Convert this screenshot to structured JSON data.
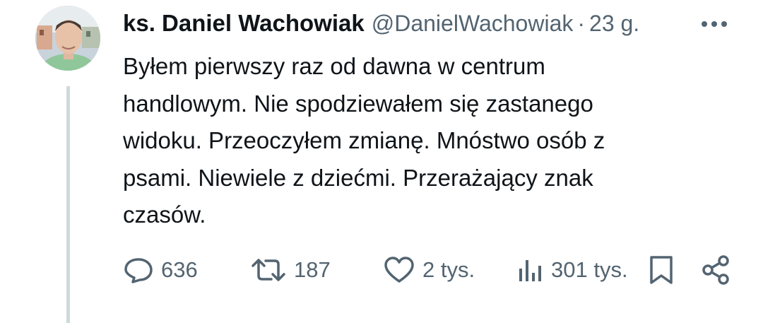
{
  "tweet": {
    "display_name": "ks. Daniel Wachowiak",
    "handle": "@DanielWachowiak",
    "separator": "·",
    "time": "23 g.",
    "text": "Byłem pierwszy raz od dawna w centrum\nhandlowym. Nie spodziewałem się zastanego\nwidoku. Przeoczyłem zmianę. Mnóstwo osób z\npsami. Niewiele z dziećmi. Przerażający znak\nczasów.",
    "stats": {
      "replies": "636",
      "reposts": "187",
      "likes": "2 tys.",
      "views": "301 tys."
    }
  },
  "icons": {
    "more": "more-horizontal-icon",
    "reply": "reply-icon",
    "repost": "repost-icon",
    "like": "heart-icon",
    "views": "views-bar-chart-icon",
    "bookmark": "bookmark-icon",
    "share": "share-icon"
  },
  "colors": {
    "text": "#0f1419",
    "secondary": "#536471",
    "thread_line": "#cfd9de"
  }
}
